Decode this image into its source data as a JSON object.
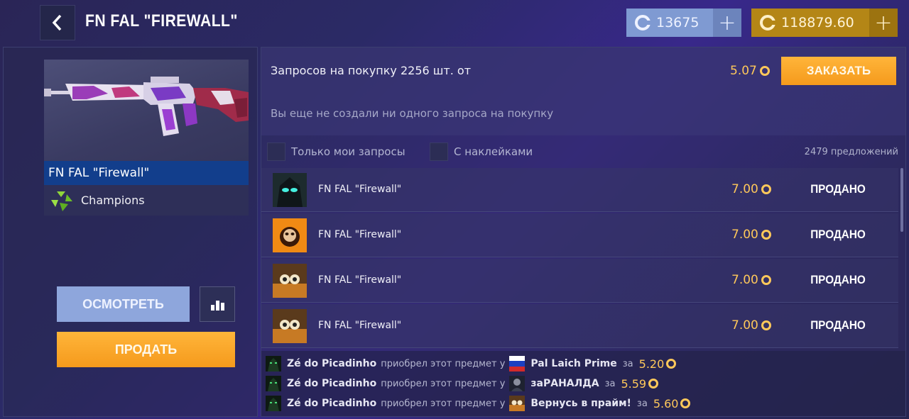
{
  "header": {
    "title": "FN FAL \"FIREWALL\"",
    "silver_balance": "13675",
    "gold_balance": "118879.60",
    "plus_label": "+"
  },
  "item": {
    "name": "FN FAL \"Firewall\"",
    "collection": "Champions",
    "inspect_label": "ОСМОТРЕТЬ",
    "sell_label": "ПРОДАТЬ"
  },
  "requests": {
    "summary": "Запросов на покупку 2256 шт. от",
    "price": "5.07",
    "order_label": "ЗАКАЗАТЬ",
    "empty_text": "Вы еще не создали ни одного запроса на покупку"
  },
  "filters": {
    "only_mine": "Только мои запросы",
    "with_stickers": "С наклейками",
    "offers_count": "2479 предложений"
  },
  "offers": [
    {
      "name": "FN FAL \"Firewall\"",
      "price": "7.00",
      "status": "ПРОДАНО",
      "avatar": "dark-green-eyes"
    },
    {
      "name": "FN FAL \"Firewall\"",
      "price": "7.00",
      "status": "ПРОДАНО",
      "avatar": "orange-fire"
    },
    {
      "name": "FN FAL \"Firewall\"",
      "price": "7.00",
      "status": "ПРОДАНО",
      "avatar": "cartoon"
    },
    {
      "name": "FN FAL \"Firewall\"",
      "price": "7.00",
      "status": "ПРОДАНО",
      "avatar": "cartoon"
    }
  ],
  "history": [
    {
      "buyer": "Zé do Picadinho",
      "verb": "приобрел этот предмет у",
      "seller": "Pal Laich Prime",
      "za": "за",
      "price": "5.20",
      "seller_avatar": "flag-ru"
    },
    {
      "buyer": "Zé do Picadinho",
      "verb": "приобрел этот предмет у",
      "seller": "заРАНАЛДА",
      "za": "за",
      "price": "5.59",
      "seller_avatar": "portrait"
    },
    {
      "buyer": "Zé do Picadinho",
      "verb": "приобрел этот предмет у",
      "seller": "Вернусь в прайм!",
      "za": "за",
      "price": "5.60",
      "seller_avatar": "cartoon"
    }
  ],
  "colors": {
    "gold": "#ffc85a",
    "silver_bg": "#7f9ad2",
    "gold_bg": "#b48616",
    "orange_button": "#f7a424",
    "selected_name_bar": "#123e8c"
  }
}
